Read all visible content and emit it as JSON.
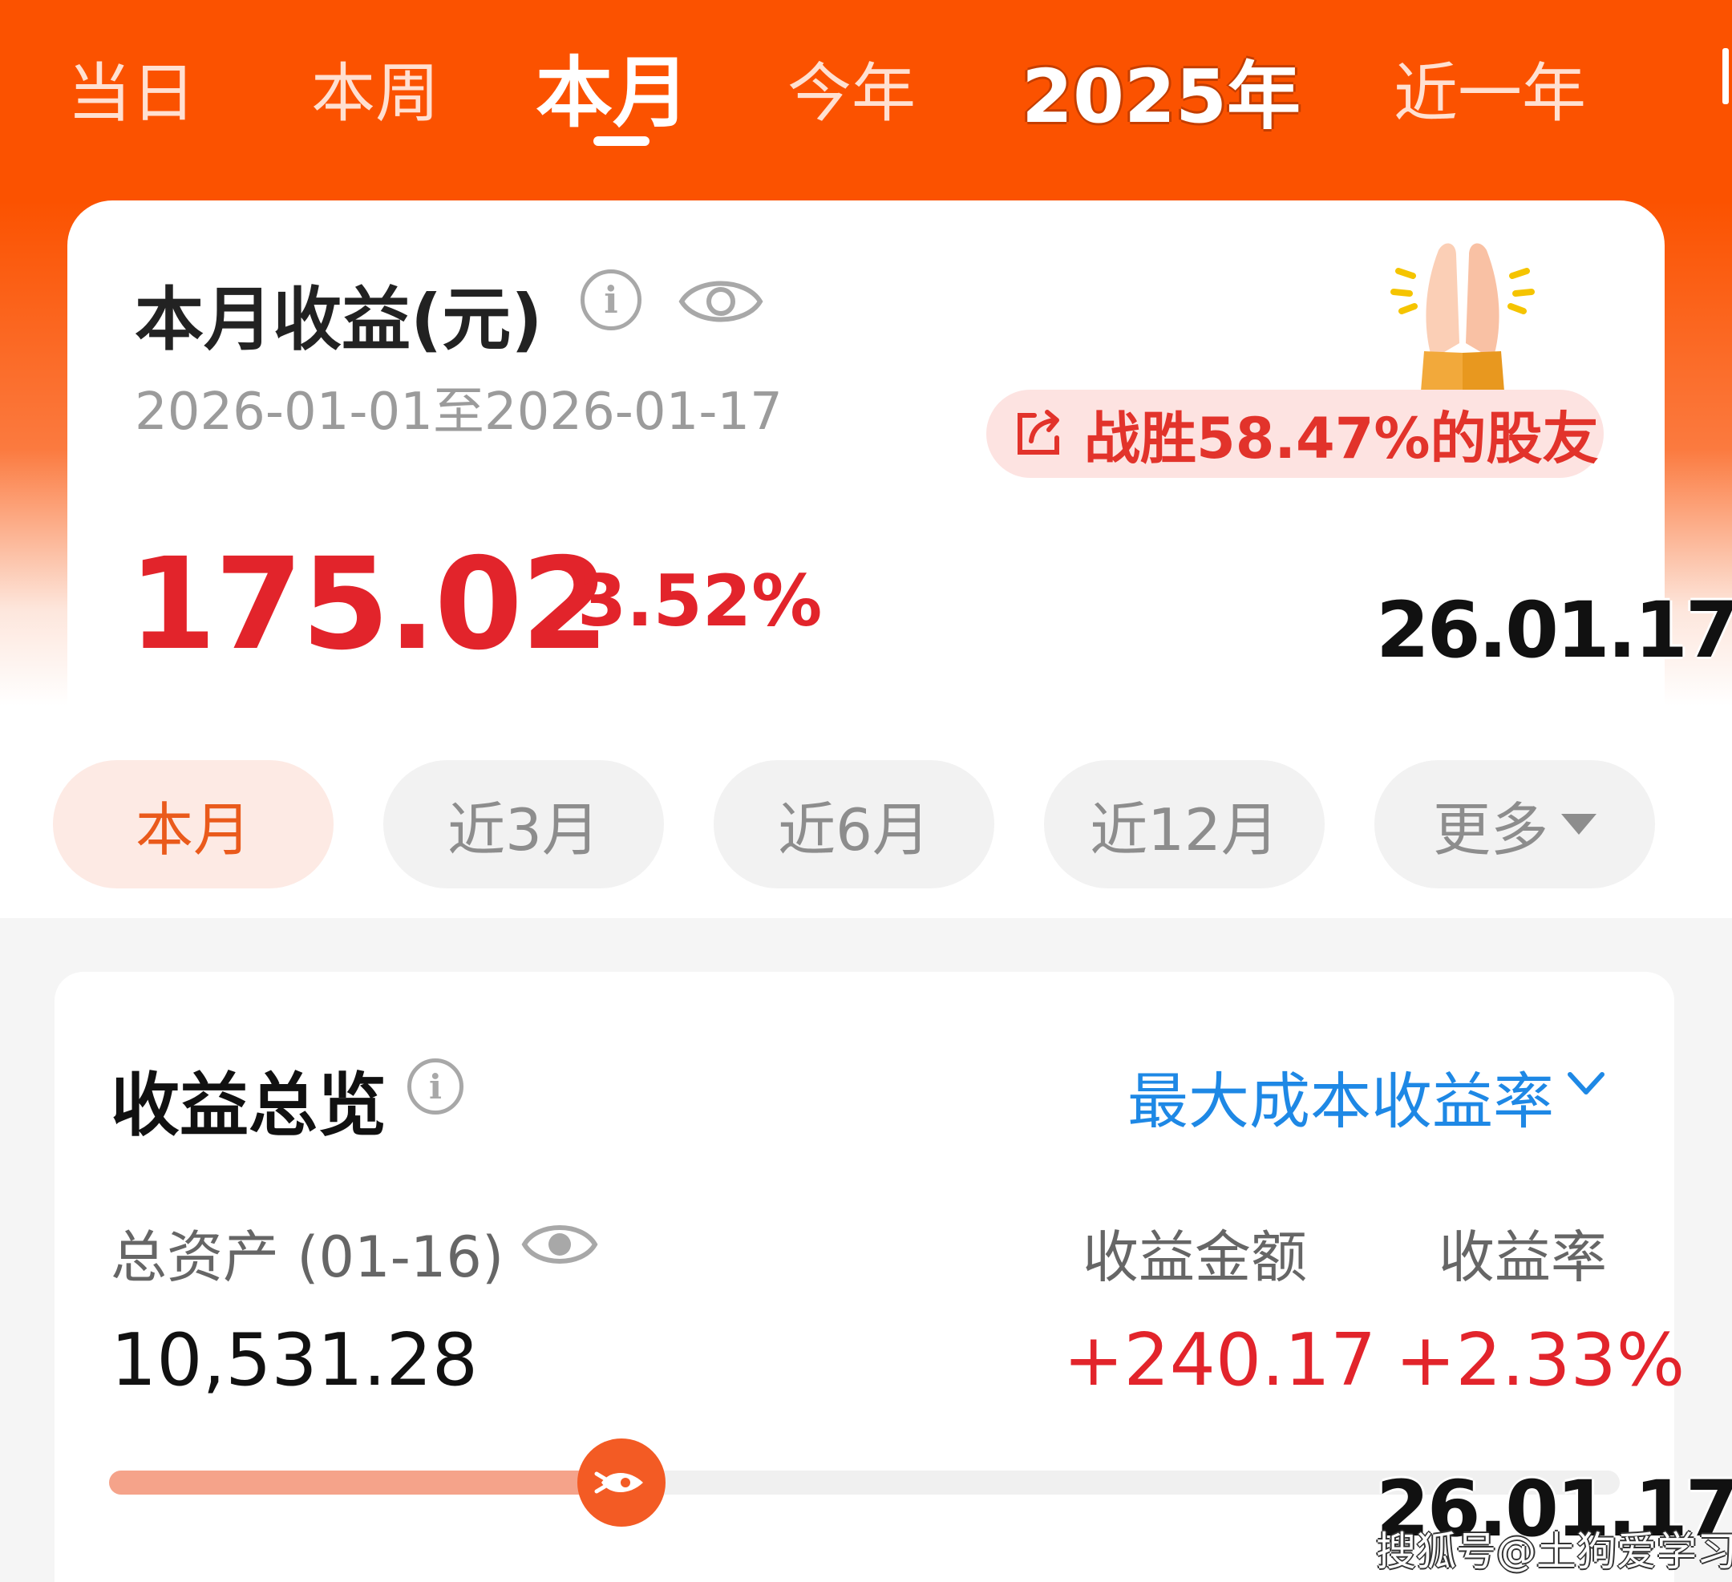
{
  "top_tabs": [
    "当日",
    "本周",
    "本月",
    "今年",
    "2025年",
    "近一年"
  ],
  "active_tab": "本月",
  "earnings": {
    "title": "本月收益(元)",
    "date_range": "2026-01-01至2026-01-17",
    "beat_text": "战胜58.47%的股友",
    "amount": "175.02",
    "percent": "3.52%",
    "info_icon": "info-icon",
    "eye_icon": "eye-icon",
    "share_icon": "share-icon",
    "illustration": "high-five-hands"
  },
  "date_stamp": "26.01.17",
  "range_options": [
    "本月",
    "近3月",
    "近6月",
    "近12月",
    "更多"
  ],
  "active_range": "本月",
  "overview": {
    "title": "收益总览",
    "sort_label": "最大成本收益率",
    "assets_label": "总资产 (01-16)",
    "amount_label": "收益金额",
    "rate_label": "收益率",
    "assets_value": "10,531.28",
    "amount_value": "+240.17",
    "rate_value": "+2.33%",
    "progress": 0.31
  },
  "watermark": "搜狐号@土狗爱学习",
  "colors": {
    "brand_orange": "#fb5200",
    "gain_red": "#e2242b",
    "link_blue": "#1e88e5",
    "pill_active_bg": "#fdeae4",
    "pill_active_text": "#ea5a1b"
  }
}
